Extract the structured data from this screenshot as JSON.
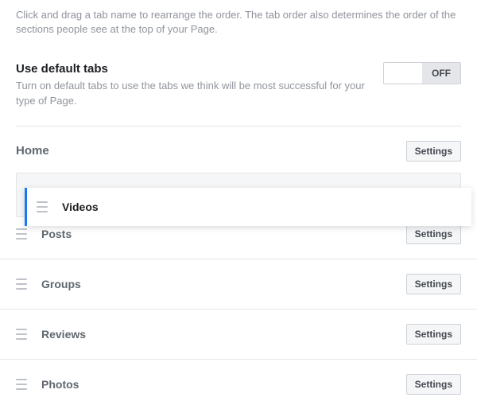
{
  "instructions": "Click and drag a tab name to rearrange the order. The tab order also determines the order of the sections people see at the top of your Page.",
  "default_tabs": {
    "title": "Use default tabs",
    "description": "Turn on default tabs to use the tabs we think will be most successful for your type of Page.",
    "toggle_on": "",
    "toggle_off": "OFF",
    "state": "off"
  },
  "home": {
    "label": "Home",
    "settings_label": "Settings"
  },
  "dragging": {
    "label": "Videos"
  },
  "tabs": [
    {
      "label": "Posts",
      "settings_label": "Settings"
    },
    {
      "label": "Groups",
      "settings_label": "Settings"
    },
    {
      "label": "Reviews",
      "settings_label": "Settings"
    },
    {
      "label": "Photos",
      "settings_label": "Settings"
    }
  ]
}
